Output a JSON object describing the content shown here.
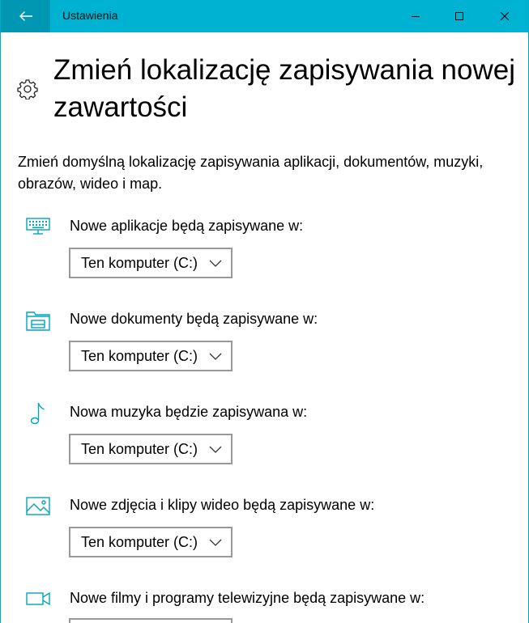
{
  "window": {
    "title": "Ustawienia"
  },
  "page": {
    "title": "Zmień lokalizację zapisywania nowej zawartości",
    "description": "Zmień domyślną lokalizację zapisywania aplikacji, dokumentów, muzyki, obrazów, wideo i map."
  },
  "locations": [
    {
      "icon": "monitor-keyboard-icon",
      "label": "Nowe aplikacje będą zapisywane w:",
      "value": "Ten komputer (C:)"
    },
    {
      "icon": "folder-drive-icon",
      "label": "Nowe dokumenty będą zapisywane w:",
      "value": "Ten komputer (C:)"
    },
    {
      "icon": "music-note-icon",
      "label": "Nowa muzyka będzie zapisywana w:",
      "value": "Ten komputer (C:)"
    },
    {
      "icon": "picture-icon",
      "label": "Nowe zdjęcia i klipy wideo będą zapisywane w:",
      "value": "Ten komputer (C:)"
    },
    {
      "icon": "video-camera-icon",
      "label": "Nowe filmy i programy telewizyjne będą zapisywane w:"
    }
  ],
  "colors": {
    "titlebar": "#00b2d1",
    "back_button": "#0097b3",
    "accent_icon": "#00a4c4",
    "dropdown_border": "#999999"
  }
}
